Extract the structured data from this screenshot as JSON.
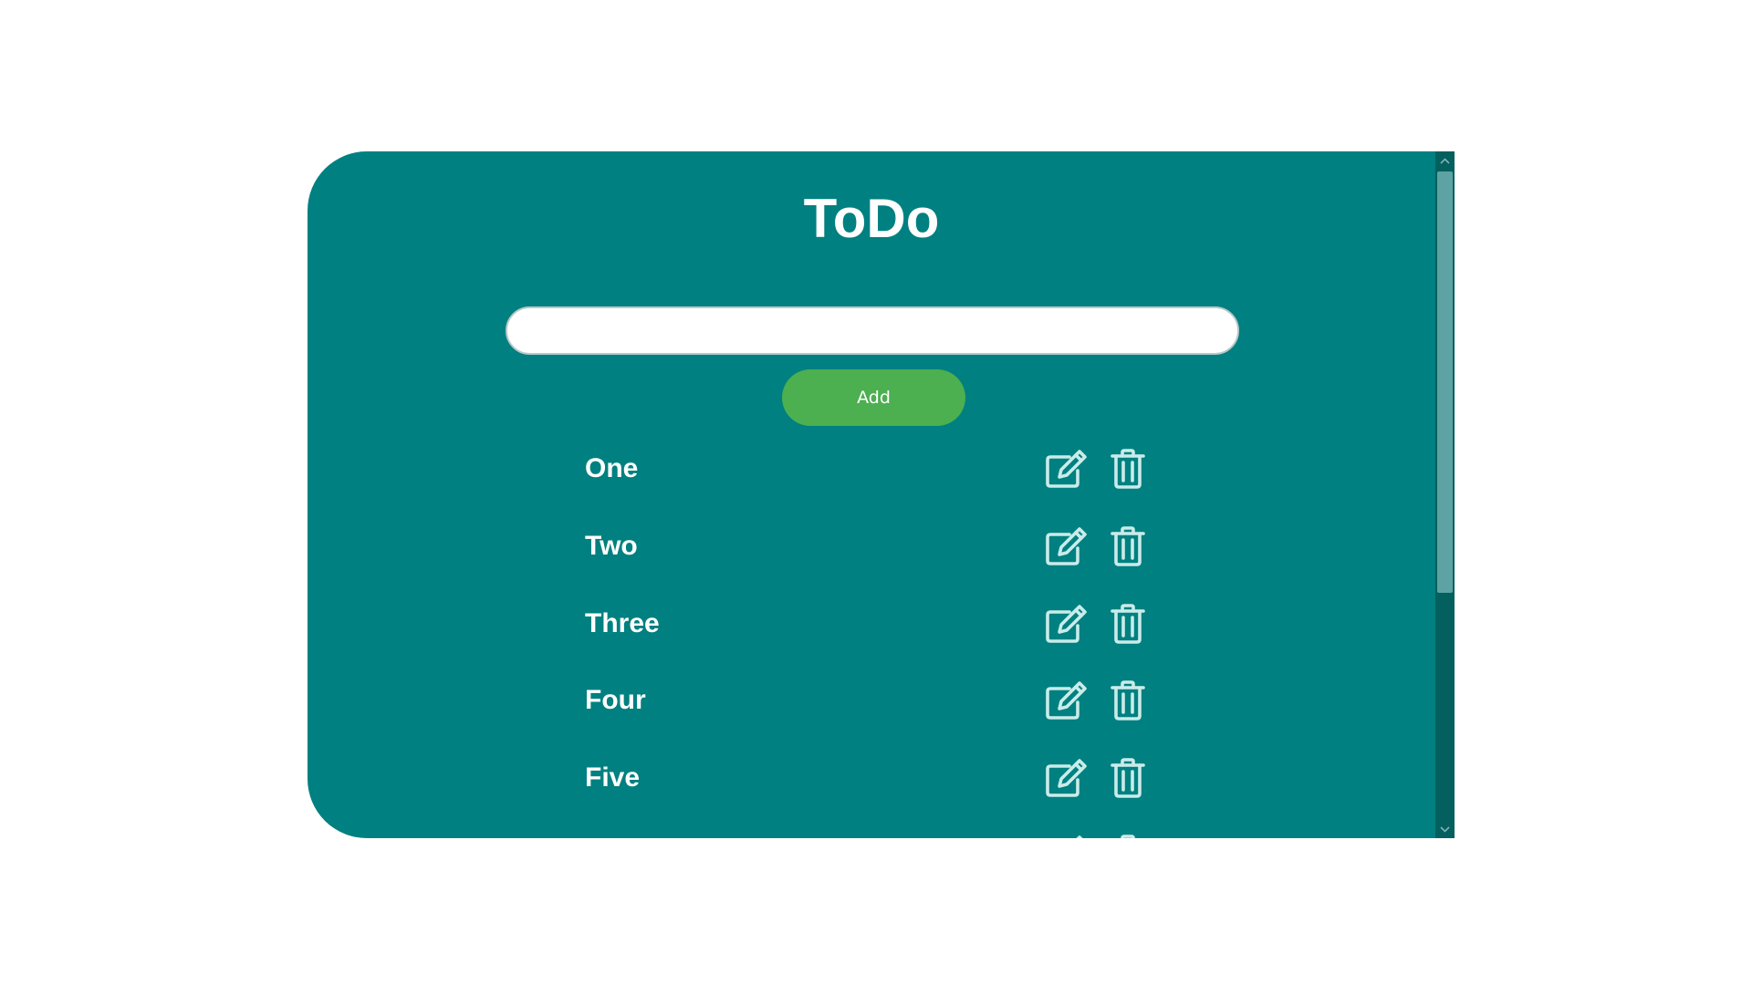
{
  "app": {
    "title": "ToDo",
    "colors": {
      "card_background": "#008080",
      "add_button": "#4caf50",
      "icon_stroke": "#c9ecea",
      "text": "#ffffff"
    }
  },
  "form": {
    "input_value": "",
    "input_placeholder": "",
    "add_label": "Add"
  },
  "tasks": [
    {
      "label": "One",
      "edit_icon": "edit-icon",
      "delete_icon": "trash-icon"
    },
    {
      "label": "Two",
      "edit_icon": "edit-icon",
      "delete_icon": "trash-icon"
    },
    {
      "label": "Three",
      "edit_icon": "edit-icon",
      "delete_icon": "trash-icon"
    },
    {
      "label": "Four",
      "edit_icon": "edit-icon",
      "delete_icon": "trash-icon"
    },
    {
      "label": "Five",
      "edit_icon": "edit-icon",
      "delete_icon": "trash-icon"
    }
  ],
  "scrollbar": {
    "up_icon": "chevron-up-icon",
    "down_icon": "chevron-down-icon"
  }
}
